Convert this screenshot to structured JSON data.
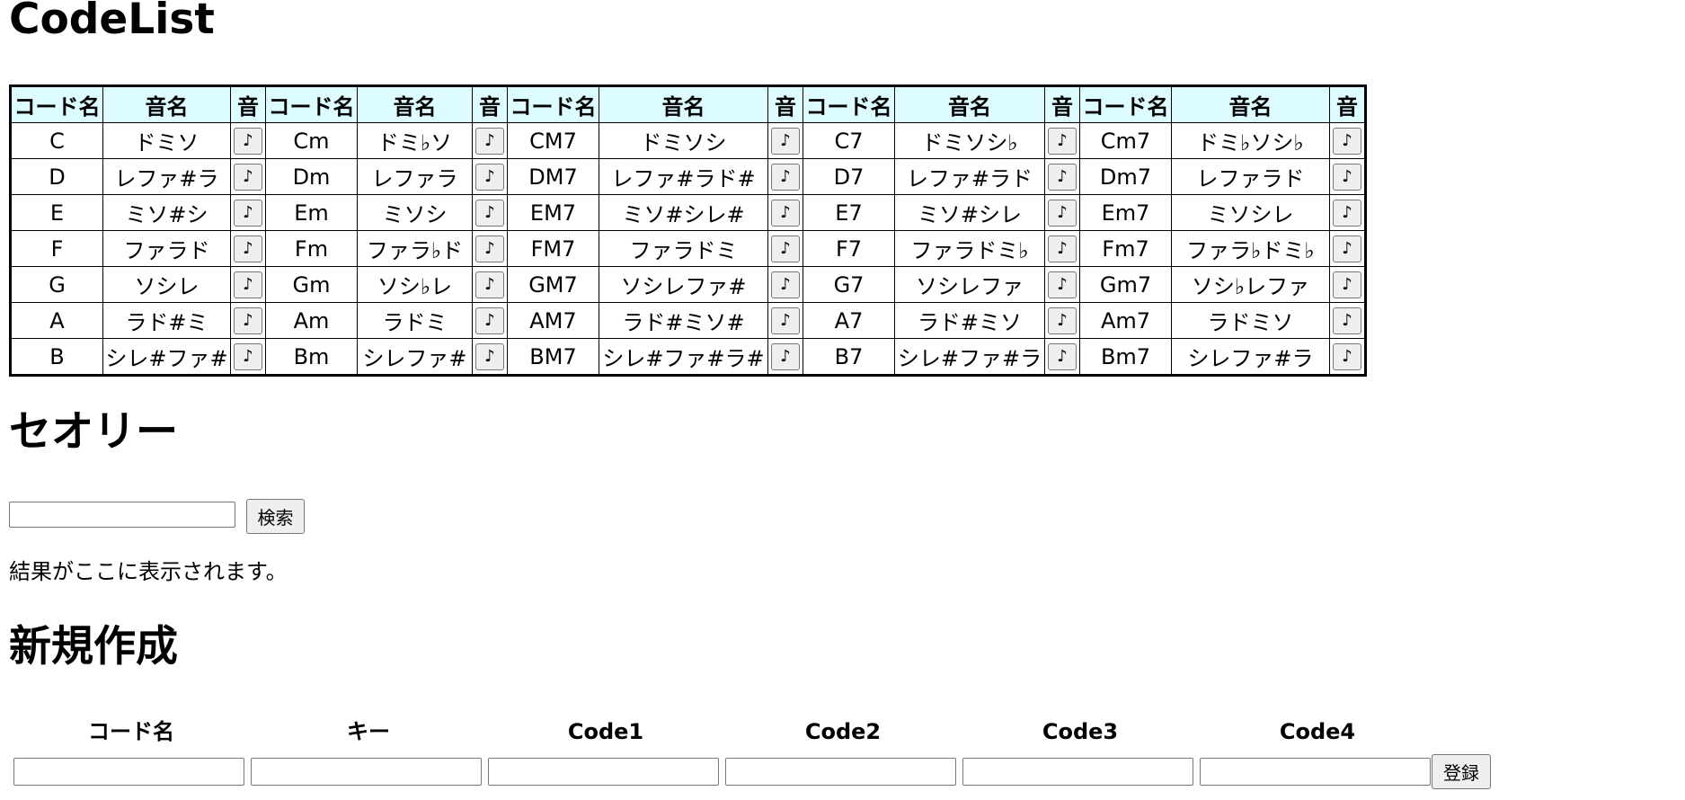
{
  "title": "CodeList",
  "table": {
    "headers": [
      "コード名",
      "音名",
      "音",
      "コード名",
      "音名",
      "音",
      "コード名",
      "音名",
      "音",
      "コード名",
      "音名",
      "音",
      "コード名",
      "音名",
      "音"
    ],
    "play_label": "♪",
    "rows": [
      [
        {
          "chord": "C",
          "notes": "ドミソ"
        },
        {
          "chord": "Cm",
          "notes": "ドミ♭ソ"
        },
        {
          "chord": "CM7",
          "notes": "ドミソシ"
        },
        {
          "chord": "C7",
          "notes": "ドミソシ♭"
        },
        {
          "chord": "Cm7",
          "notes": "ドミ♭ソシ♭"
        }
      ],
      [
        {
          "chord": "D",
          "notes": "レファ#ラ"
        },
        {
          "chord": "Dm",
          "notes": "レファラ"
        },
        {
          "chord": "DM7",
          "notes": "レファ#ラド#"
        },
        {
          "chord": "D7",
          "notes": "レファ#ラド"
        },
        {
          "chord": "Dm7",
          "notes": "レファラド"
        }
      ],
      [
        {
          "chord": "E",
          "notes": "ミソ#シ"
        },
        {
          "chord": "Em",
          "notes": "ミソシ"
        },
        {
          "chord": "EM7",
          "notes": "ミソ#シレ#"
        },
        {
          "chord": "E7",
          "notes": "ミソ#シレ"
        },
        {
          "chord": "Em7",
          "notes": "ミソシレ"
        }
      ],
      [
        {
          "chord": "F",
          "notes": "ファラド"
        },
        {
          "chord": "Fm",
          "notes": "ファラ♭ド"
        },
        {
          "chord": "FM7",
          "notes": "ファラドミ"
        },
        {
          "chord": "F7",
          "notes": "ファラドミ♭"
        },
        {
          "chord": "Fm7",
          "notes": "ファラ♭ドミ♭"
        }
      ],
      [
        {
          "chord": "G",
          "notes": "ソシレ"
        },
        {
          "chord": "Gm",
          "notes": "ソシ♭レ"
        },
        {
          "chord": "GM7",
          "notes": "ソシレファ#"
        },
        {
          "chord": "G7",
          "notes": "ソシレファ"
        },
        {
          "chord": "Gm7",
          "notes": "ソシ♭レファ"
        }
      ],
      [
        {
          "chord": "A",
          "notes": "ラド#ミ"
        },
        {
          "chord": "Am",
          "notes": "ラドミ"
        },
        {
          "chord": "AM7",
          "notes": "ラド#ミソ#"
        },
        {
          "chord": "A7",
          "notes": "ラド#ミソ"
        },
        {
          "chord": "Am7",
          "notes": "ラドミソ"
        }
      ],
      [
        {
          "chord": "B",
          "notes": "シレ#ファ#"
        },
        {
          "chord": "Bm",
          "notes": "シレファ#"
        },
        {
          "chord": "BM7",
          "notes": "シレ#ファ#ラ#"
        },
        {
          "chord": "B7",
          "notes": "シレ#ファ#ラ"
        },
        {
          "chord": "Bm7",
          "notes": "シレファ#ラ"
        }
      ]
    ]
  },
  "theory": {
    "title": "セオリー",
    "search_value": "",
    "search_button": "検索",
    "result": "結果がここに表示されます。"
  },
  "new_entry": {
    "title": "新規作成",
    "labels": [
      "コード名",
      "キー",
      "Code1",
      "Code2",
      "Code3",
      "Code4"
    ],
    "values": [
      "",
      "",
      "",
      "",
      "",
      ""
    ],
    "submit_label": "登録"
  }
}
